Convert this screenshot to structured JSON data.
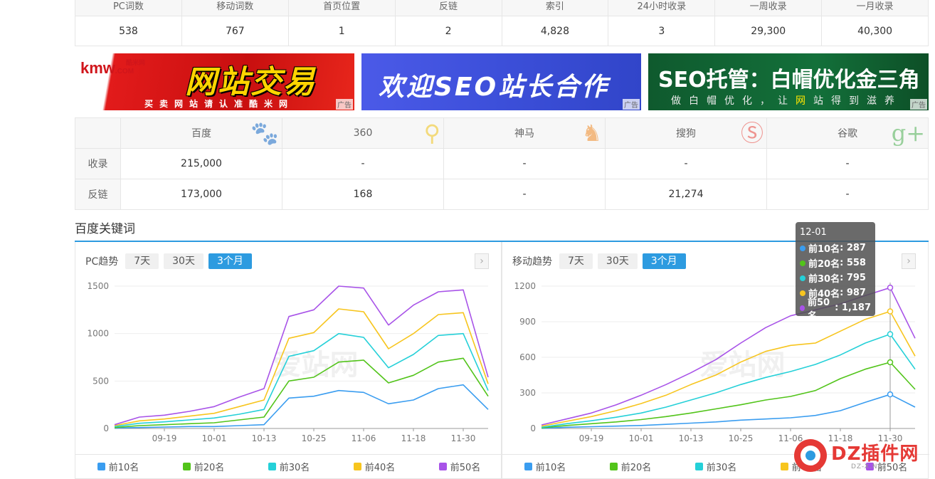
{
  "stats": {
    "headers": [
      "PC词数",
      "移动词数",
      "首页位置",
      "反链",
      "索引",
      "24小时收录",
      "一周收录",
      "一月收录"
    ],
    "values": [
      "538",
      "767",
      "1",
      "2",
      "4,828",
      "3",
      "29,300",
      "40,300"
    ]
  },
  "ads": [
    {
      "logo": "kmw",
      "logo_domain": ".COM",
      "logo_brand": "酷米网",
      "headline": "网站交易",
      "sub": "买卖网站请认准酷米网",
      "tag": "广告"
    },
    {
      "headline": "欢迎SEO站长合作",
      "tag": "广告"
    },
    {
      "headline": "SEO托管：白帽优化金三角",
      "sub_before": "做白帽优化，让",
      "sub_highlight": "网",
      "sub_after": "站得到滋养",
      "tag": "广告"
    }
  ],
  "engines": {
    "headers": [
      "百度",
      "360",
      "神马",
      "搜狗",
      "谷歌"
    ],
    "icons": [
      "baidu-paw-icon",
      "360-search-icon",
      "shenma-icon",
      "sogou-icon",
      "google-plus-icon"
    ],
    "rows": [
      {
        "label": "收录",
        "values": [
          "215,000",
          "-",
          "-",
          "-",
          "-"
        ]
      },
      {
        "label": "反链",
        "values": [
          "173,000",
          "168",
          "-",
          "21,274",
          "-"
        ]
      }
    ]
  },
  "section_title": "百度关键词",
  "pc_panel": {
    "title": "PC趋势",
    "ranges": [
      "7天",
      "30天",
      "3个月"
    ],
    "active": 2,
    "watermark": "爱站网"
  },
  "mobile_panel": {
    "title": "移动趋势",
    "ranges": [
      "7天",
      "30天",
      "3个月"
    ],
    "active": 2,
    "watermark": "爱站网"
  },
  "legend": [
    "前10名",
    "前20名",
    "前30名",
    "前40名",
    "前50名"
  ],
  "colors": {
    "top10": "#3a9df0",
    "top20": "#52c41a",
    "top30": "#25d0d8",
    "top40": "#f7c51e",
    "top50": "#a853e8",
    "accent": "#2d9be0"
  },
  "tooltip": {
    "date": "12-01",
    "rows": [
      {
        "label": "前10名",
        "value": "287"
      },
      {
        "label": "前20名",
        "value": "558"
      },
      {
        "label": "前30名",
        "value": "795"
      },
      {
        "label": "前40名",
        "value": "987"
      },
      {
        "label": "前50名",
        "value": "1,187"
      }
    ]
  },
  "footer_watermark": {
    "text": "DZ插件网",
    "sub": "DZ-X.NET"
  },
  "chart_data": [
    {
      "type": "line",
      "title": "PC趋势",
      "x_ticks": [
        "09-19",
        "10-01",
        "10-13",
        "10-25",
        "11-06",
        "11-18",
        "11-30"
      ],
      "ylim": [
        0,
        1500
      ],
      "y_ticks": [
        0,
        500,
        1000,
        1500
      ],
      "x": [
        0,
        6,
        12,
        18,
        24,
        30,
        36,
        42,
        48,
        54,
        60,
        66,
        72,
        78,
        84,
        90
      ],
      "x_tick_index": [
        12,
        24,
        36,
        48,
        60,
        72,
        84
      ],
      "series": [
        {
          "name": "前10名",
          "values": [
            5,
            10,
            15,
            20,
            20,
            30,
            40,
            320,
            340,
            400,
            380,
            260,
            300,
            420,
            460,
            200
          ]
        },
        {
          "name": "前20名",
          "values": [
            10,
            30,
            40,
            50,
            60,
            90,
            120,
            500,
            540,
            700,
            720,
            480,
            560,
            700,
            740,
            340
          ]
        },
        {
          "name": "前30名",
          "values": [
            20,
            55,
            70,
            90,
            110,
            150,
            200,
            760,
            820,
            1000,
            960,
            640,
            780,
            980,
            1000,
            400
          ]
        },
        {
          "name": "前40名",
          "values": [
            30,
            80,
            100,
            130,
            160,
            230,
            300,
            950,
            1010,
            1260,
            1230,
            840,
            1000,
            1200,
            1220,
            470
          ]
        },
        {
          "name": "前50名",
          "values": [
            40,
            120,
            140,
            180,
            230,
            330,
            420,
            1180,
            1250,
            1500,
            1480,
            1090,
            1300,
            1440,
            1460,
            540
          ]
        }
      ]
    },
    {
      "type": "line",
      "title": "移动趋势",
      "x_ticks": [
        "09-19",
        "10-01",
        "10-13",
        "10-25",
        "11-06",
        "11-18",
        "11-30"
      ],
      "ylim": [
        0,
        1200
      ],
      "y_ticks": [
        0,
        300,
        600,
        900,
        1200
      ],
      "x": [
        0,
        6,
        12,
        18,
        24,
        30,
        36,
        42,
        48,
        54,
        60,
        66,
        72,
        78,
        84,
        90
      ],
      "x_tick_index": [
        12,
        24,
        36,
        48,
        60,
        72,
        84
      ],
      "series": [
        {
          "name": "前10名",
          "values": [
            2,
            10,
            15,
            20,
            25,
            35,
            45,
            55,
            70,
            80,
            90,
            110,
            150,
            220,
            287,
            180
          ]
        },
        {
          "name": "前20名",
          "values": [
            5,
            25,
            40,
            55,
            75,
            100,
            130,
            165,
            200,
            240,
            270,
            320,
            420,
            500,
            558,
            330
          ]
        },
        {
          "name": "前30名",
          "values": [
            10,
            40,
            65,
            95,
            130,
            180,
            240,
            300,
            370,
            430,
            480,
            540,
            620,
            720,
            795,
            500
          ]
        },
        {
          "name": "前40名",
          "values": [
            20,
            60,
            100,
            150,
            210,
            280,
            370,
            450,
            560,
            650,
            700,
            720,
            820,
            920,
            987,
            610
          ]
        },
        {
          "name": "前50名",
          "values": [
            30,
            80,
            130,
            200,
            280,
            370,
            470,
            580,
            720,
            850,
            950,
            1000,
            1050,
            1120,
            1187,
            760
          ]
        }
      ]
    }
  ]
}
